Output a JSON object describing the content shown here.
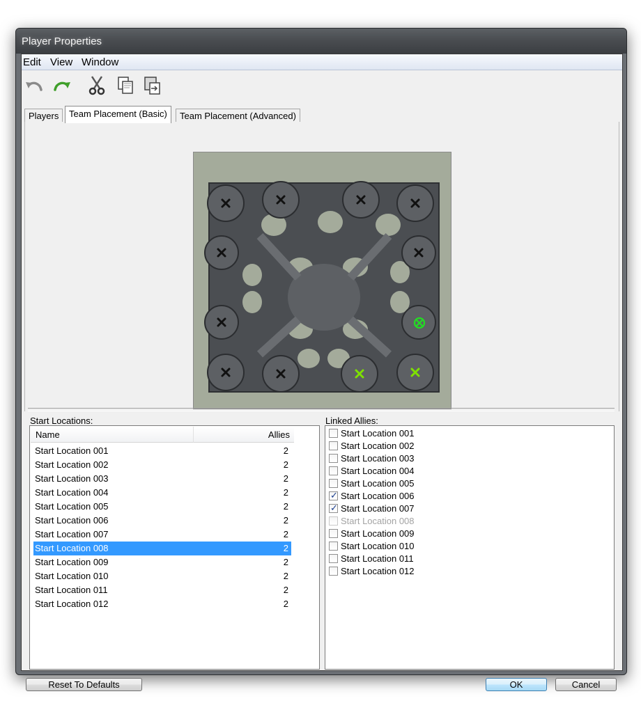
{
  "window": {
    "title": "Player Properties"
  },
  "menu": [
    "Edit",
    "View",
    "Window"
  ],
  "toolbar": {
    "icons": [
      "undo-icon",
      "redo-icon",
      "cut-icon",
      "copy-icon",
      "paste-icon"
    ]
  },
  "tabs": [
    {
      "label": "Players",
      "active": false
    },
    {
      "label": "Team Placement (Basic)",
      "active": true
    },
    {
      "label": "Team Placement (Advanced)",
      "active": false
    }
  ],
  "start_locations": {
    "label": "Start Locations:",
    "columns": [
      "Name",
      "Allies"
    ],
    "selected_index": 7,
    "rows": [
      {
        "name": "Start Location 001",
        "allies": "2"
      },
      {
        "name": "Start Location 002",
        "allies": "2"
      },
      {
        "name": "Start Location 003",
        "allies": "2"
      },
      {
        "name": "Start Location 004",
        "allies": "2"
      },
      {
        "name": "Start Location 005",
        "allies": "2"
      },
      {
        "name": "Start Location 006",
        "allies": "2"
      },
      {
        "name": "Start Location 007",
        "allies": "2"
      },
      {
        "name": "Start Location 008",
        "allies": "2"
      },
      {
        "name": "Start Location 009",
        "allies": "2"
      },
      {
        "name": "Start Location 010",
        "allies": "2"
      },
      {
        "name": "Start Location 011",
        "allies": "2"
      },
      {
        "name": "Start Location 012",
        "allies": "2"
      }
    ]
  },
  "linked_allies": {
    "label": "Linked Allies:",
    "items": [
      {
        "label": "Start Location 001",
        "checked": false,
        "disabled": false
      },
      {
        "label": "Start Location 002",
        "checked": false,
        "disabled": false
      },
      {
        "label": "Start Location 003",
        "checked": false,
        "disabled": false
      },
      {
        "label": "Start Location 004",
        "checked": false,
        "disabled": false
      },
      {
        "label": "Start Location 005",
        "checked": false,
        "disabled": false
      },
      {
        "label": "Start Location 006",
        "checked": true,
        "disabled": false
      },
      {
        "label": "Start Location 007",
        "checked": true,
        "disabled": false
      },
      {
        "label": "Start Location 008",
        "checked": false,
        "disabled": true
      },
      {
        "label": "Start Location 009",
        "checked": false,
        "disabled": false
      },
      {
        "label": "Start Location 010",
        "checked": false,
        "disabled": false
      },
      {
        "label": "Start Location 011",
        "checked": false,
        "disabled": false
      },
      {
        "label": "Start Location 012",
        "checked": false,
        "disabled": false
      }
    ]
  },
  "map": {
    "colors": {
      "background": "#a4ab9b",
      "terrain": "#4b4e52",
      "plateau": "#5d6064",
      "marker_normal": "#111111",
      "marker_ally": "#7ee000",
      "marker_selected": "#22dd22"
    }
  },
  "buttons": {
    "reset": "Reset To Defaults",
    "ok": "OK",
    "cancel": "Cancel"
  }
}
